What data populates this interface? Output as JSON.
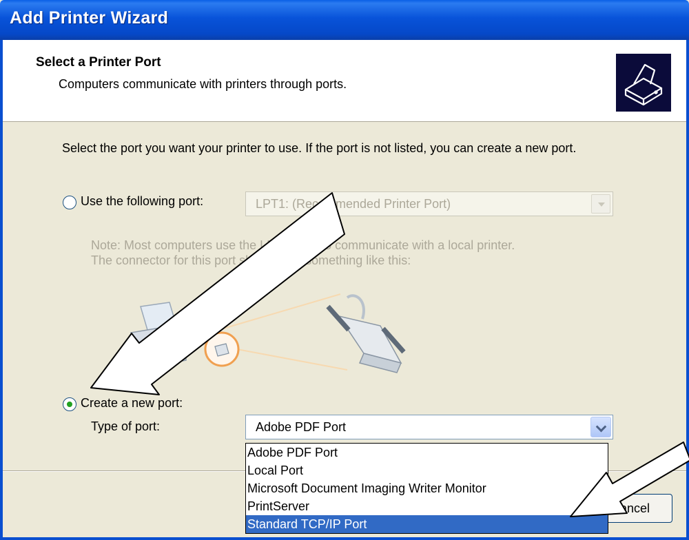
{
  "window": {
    "title": "Add Printer Wizard"
  },
  "header": {
    "title": "Select a Printer Port",
    "subtitle": "Computers communicate with printers through ports.",
    "icon": "printer-wizard-icon"
  },
  "content": {
    "instruction": "Select the port you want your printer to use.  If the port is not listed, you can create a new port.",
    "use_port": {
      "label": "Use the following port:",
      "selected": false,
      "value": "LPT1: (Recommended Printer Port)"
    },
    "note": {
      "line1": "Note: Most computers use the LPT1: port to communicate with a local printer.",
      "line2": "The connector for this port should look something like this:"
    },
    "create_port": {
      "label": "Create a new port:",
      "selected": true,
      "type_label": "Type of port:",
      "value": "Adobe PDF Port",
      "options": [
        "Adobe PDF Port",
        "Local Port",
        "Microsoft Document Imaging Writer Monitor",
        "PrintServer",
        "Standard TCP/IP Port"
      ],
      "highlighted_option": "Standard TCP/IP Port"
    }
  },
  "footer": {
    "cancel_label": "Cancel"
  },
  "colors": {
    "titlebar": "#0548C8",
    "highlight": "#316AC5",
    "annotation_arrow": "#000000"
  }
}
